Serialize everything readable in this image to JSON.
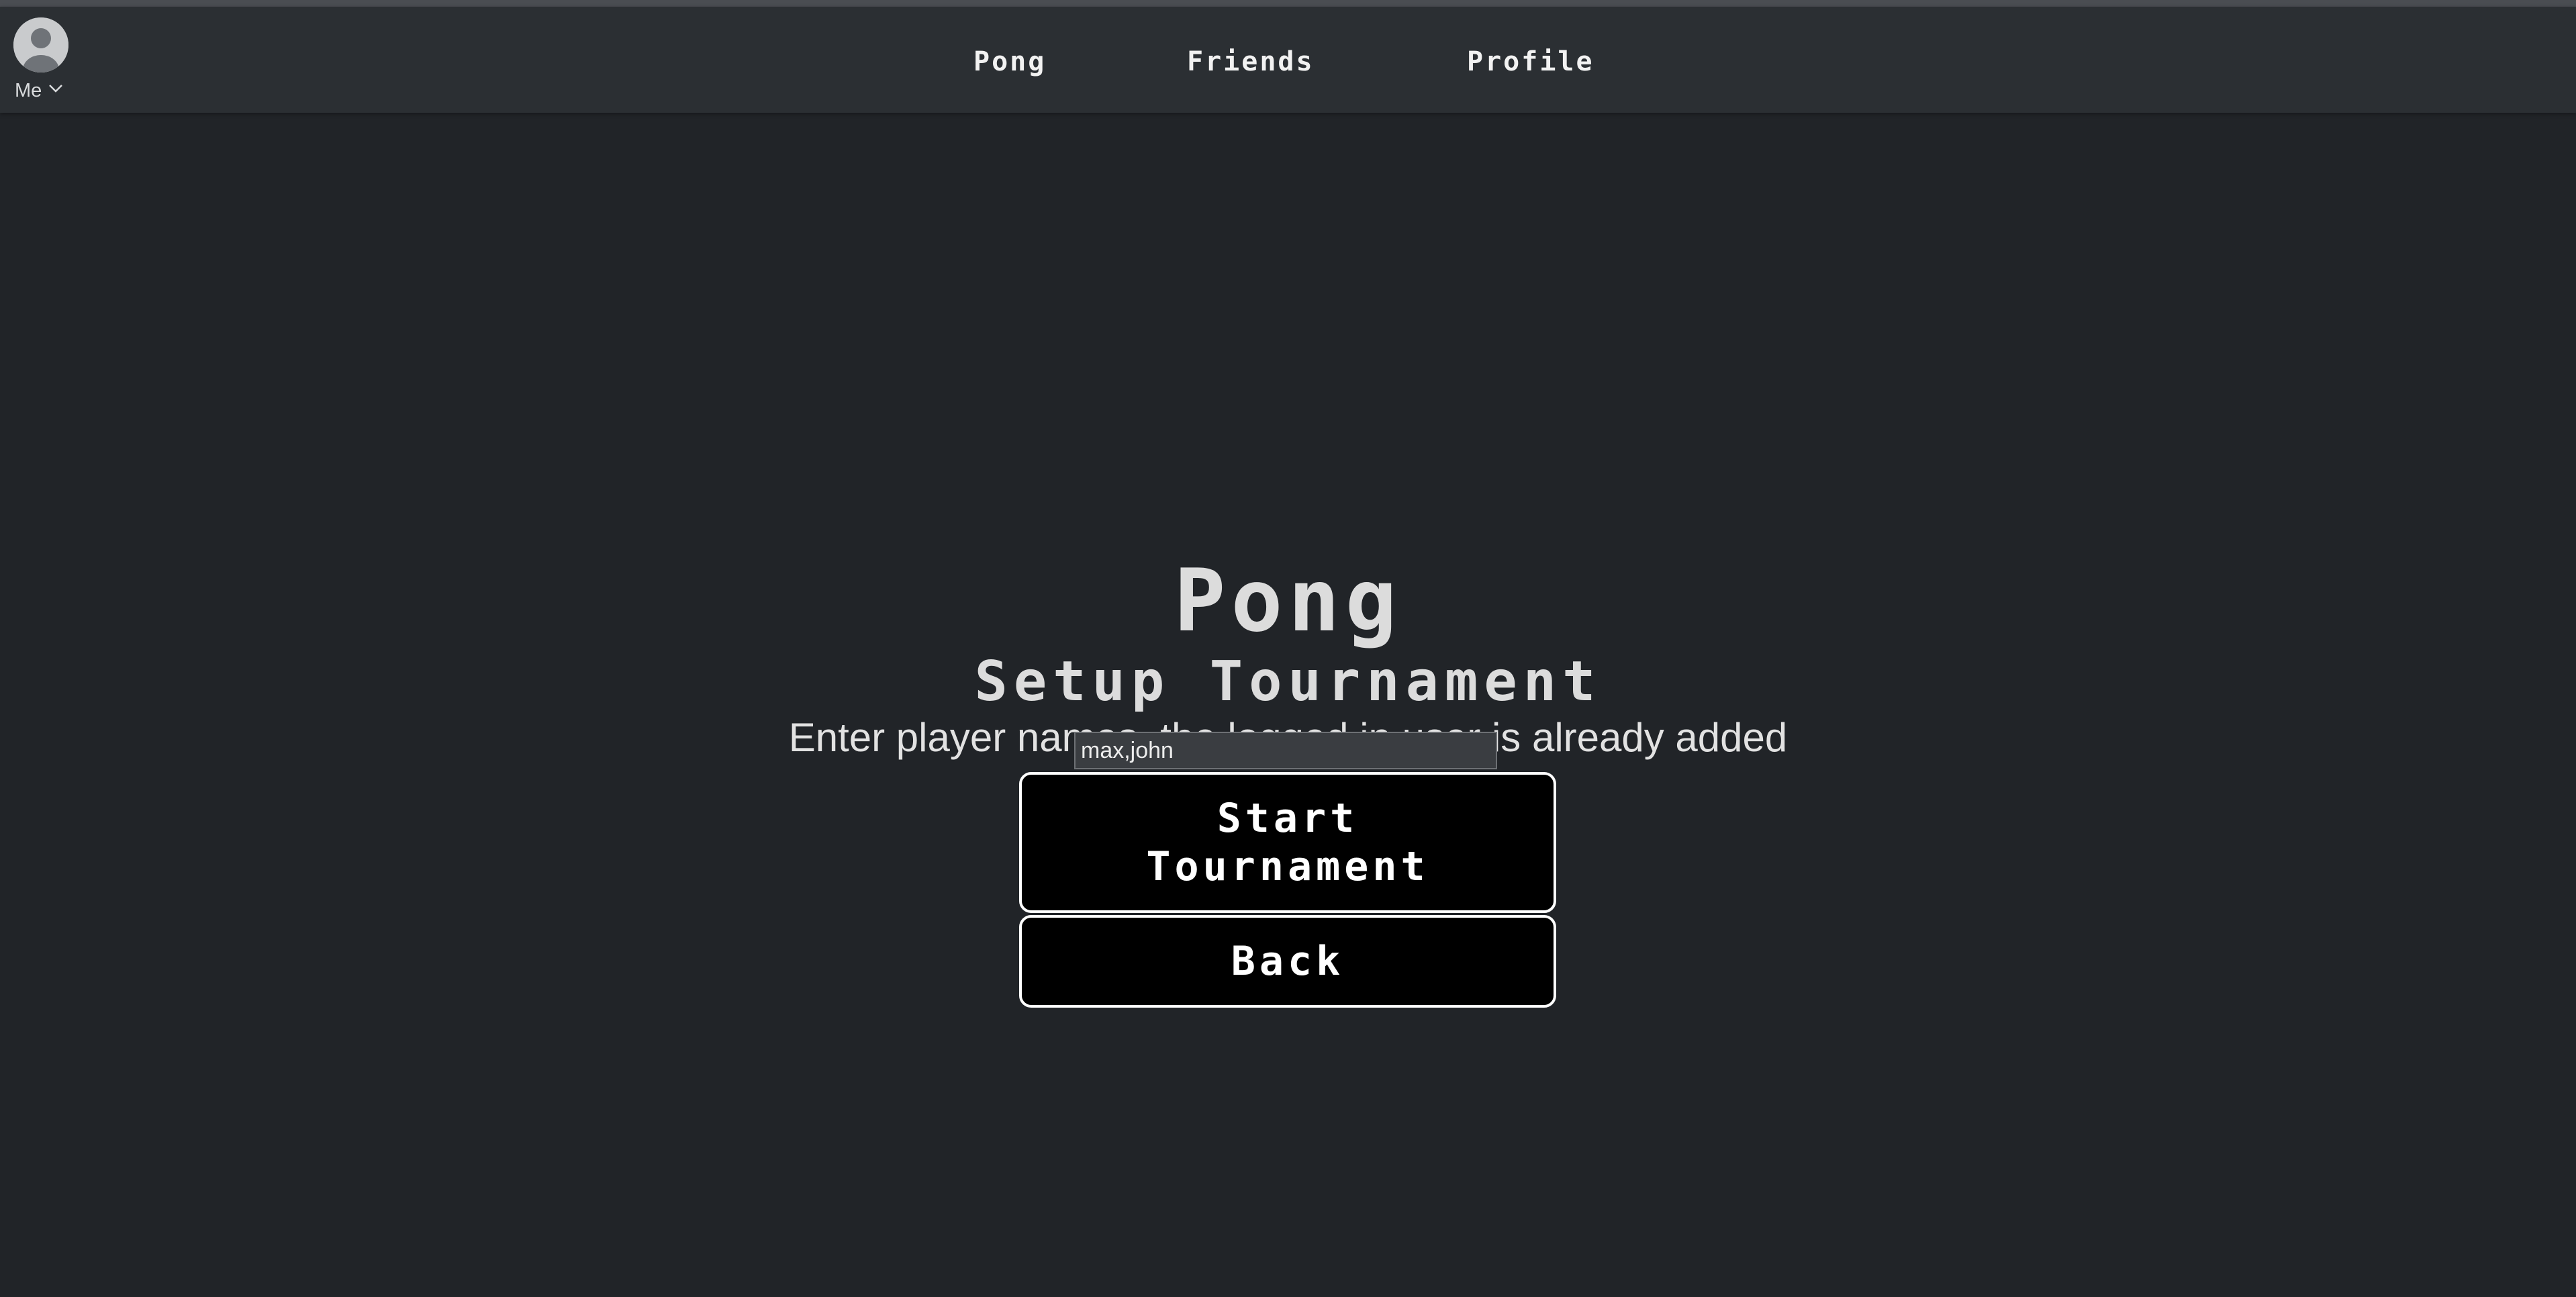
{
  "navbar": {
    "user_menu": {
      "label": "Me",
      "icon": "user-avatar-icon",
      "chevron_icon": "chevron-down-icon"
    },
    "links": [
      "Pong",
      "Friends",
      "Profile"
    ]
  },
  "main": {
    "title": "Pong",
    "subtitle": "Setup Tournament",
    "instructions": "Enter player names, the logged in user is already added",
    "player_names_input": {
      "value": "max,john"
    },
    "start_button": "Start Tournament",
    "back_button": "Back"
  },
  "colors": {
    "background": "#212428",
    "navbar": "#2b2f33",
    "button_bg": "#000000",
    "button_border": "#ffffff",
    "text": "#dcdcdc"
  }
}
